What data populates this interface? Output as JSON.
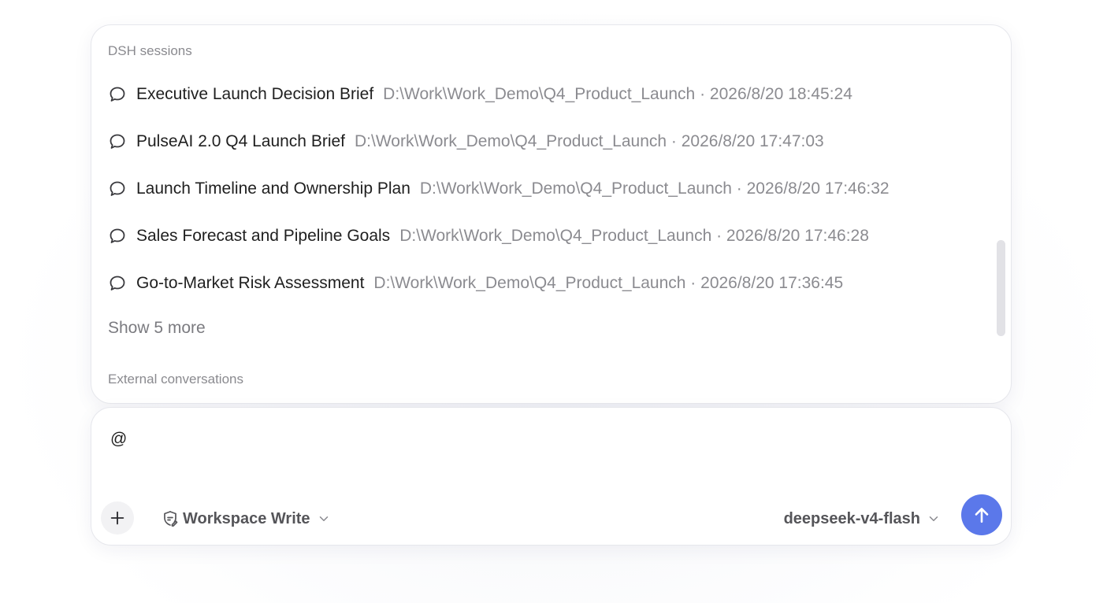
{
  "popup": {
    "sessions_header": "DSH sessions",
    "sessions": [
      {
        "title": "Executive Launch Decision Brief",
        "meta": "D:\\Work\\Work_Demo\\Q4_Product_Launch · 2026/8/20 18:45:24",
        "icon": "chat-bubble-icon"
      },
      {
        "title": "PulseAI 2.0 Q4 Launch Brief",
        "meta": "D:\\Work\\Work_Demo\\Q4_Product_Launch · 2026/8/20 17:47:03",
        "icon": "chat-bubble-icon"
      },
      {
        "title": "Launch Timeline and Ownership Plan",
        "meta": "D:\\Work\\Work_Demo\\Q4_Product_Launch · 2026/8/20 17:46:32",
        "icon": "chat-bubble-icon"
      },
      {
        "title": "Sales Forecast and Pipeline Goals",
        "meta": "D:\\Work\\Work_Demo\\Q4_Product_Launch · 2026/8/20 17:46:28",
        "icon": "chat-bubble-icon"
      },
      {
        "title": "Go-to-Market Risk Assessment",
        "meta": "D:\\Work\\Work_Demo\\Q4_Product_Launch · 2026/8/20 17:36:45",
        "icon": "chat-bubble-icon"
      }
    ],
    "show_more_label": "Show 5 more",
    "external_header": "External conversations"
  },
  "composer": {
    "input_value": "@",
    "add_icon": "plus-icon",
    "permission_icon": "shield-edit-icon",
    "permission_label": "Workspace Write",
    "model_label": "deepseek-v4-flash",
    "send_icon": "arrow-up-icon",
    "accent_color": "#5b78ea"
  }
}
